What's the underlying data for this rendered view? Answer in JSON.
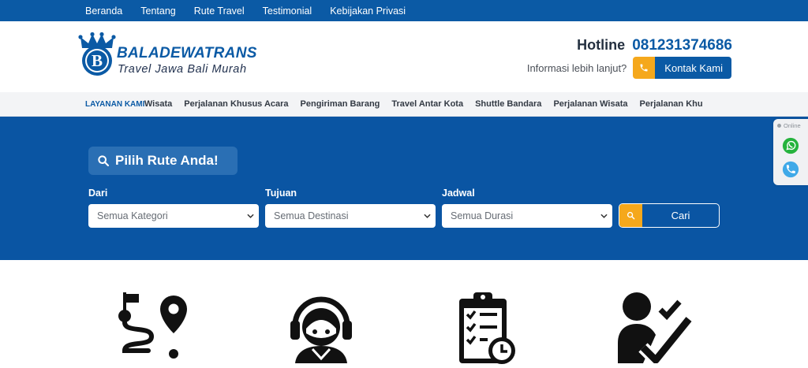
{
  "topnav": {
    "items": [
      "Beranda",
      "Tentang",
      "Rute Travel",
      "Testimonial",
      "Kebijakan Privasi"
    ]
  },
  "header": {
    "brand": "BALADEWATRANS",
    "tagline": "Travel Jawa Bali Murah",
    "logo_letter": "B",
    "hotline_label": "Hotline",
    "hotline_number": "081231374686",
    "info_text": "Informasi lebih lanjut?",
    "contact_button": "Kontak Kami"
  },
  "services": {
    "label": "LAYANAN KAMI",
    "items": [
      "an Wisata",
      "Perjalanan Khusus Acara",
      "Pengiriman Barang",
      "Travel Antar Kota",
      "Shuttle Bandara",
      "Perjalanan Wisata",
      "Perjalanan Khu"
    ]
  },
  "search": {
    "title": "Pilih Rute Anda!",
    "dari_label": "Dari",
    "tujuan_label": "Tujuan",
    "jadwal_label": "Jadwal",
    "dari_value": "Semua Kategori",
    "tujuan_value": "Semua Destinasi",
    "jadwal_value": "Semua Durasi",
    "submit": "Cari"
  },
  "float_widget": {
    "status": "Online",
    "icons": [
      "whatsapp-icon",
      "phone-icon"
    ]
  },
  "features": {
    "icons": [
      "route-map-icon",
      "customer-service-icon",
      "schedule-clipboard-icon",
      "trusted-person-icon"
    ]
  },
  "colors": {
    "primary": "#0b5aa5",
    "hero": "#0a55a3",
    "accent": "#f5a81c"
  }
}
